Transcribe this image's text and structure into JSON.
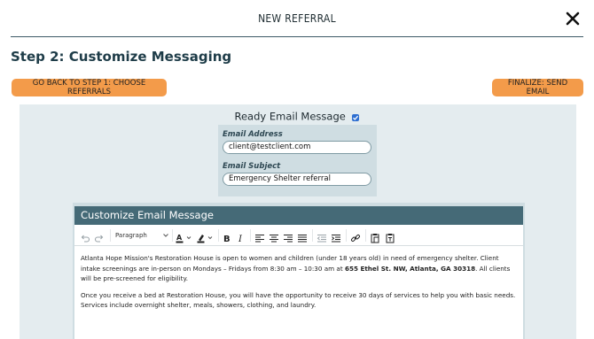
{
  "header": {
    "title": "NEW REFERRAL",
    "close_icon": "close-icon"
  },
  "step_title": "Step 2: Customize Messaging",
  "buttons": {
    "back_label": "GO BACK TO STEP 1: CHOOSE REFERRALS",
    "finalize_label": "FINALIZE: SEND EMAIL",
    "accent_color": "#f39b4a"
  },
  "ready": {
    "label": "Ready Email Message",
    "checked": true
  },
  "email": {
    "address_label": "Email Address",
    "address_value": "client@testclient.com",
    "subject_label": "Email Subject",
    "subject_value": "Emergency Shelter referral"
  },
  "editor": {
    "title": "Customize Email Message",
    "block_format": "Paragraph",
    "toolbar_icons": [
      "undo-icon",
      "redo-icon",
      "paragraph-select",
      "text-color-icon",
      "highlight-icon",
      "bold-icon",
      "italic-icon",
      "align-left-icon",
      "align-center-icon",
      "align-right-icon",
      "align-justify-icon",
      "outdent-icon",
      "indent-icon",
      "link-icon",
      "paste-icon",
      "paste-text-icon"
    ],
    "para1_before": "Atlanta Hope Mission's Restoration House is open to women and children (under 18 years old) in need of emergency shelter. Client intake screenings are in-person on Mondays – Fridays from 8:30 am – 10:30 am at ",
    "para1_bold": "655 Ethel St. NW, Atlanta, GA 30318",
    "para1_after": ". All clients will be pre-screened for eligibility.",
    "para2": "Once you receive a bed at Restoration House, you will have the opportunity to receive 30 days of services to help you with basic needs. Services include overnight shelter, meals, showers, clothing, and laundry."
  }
}
